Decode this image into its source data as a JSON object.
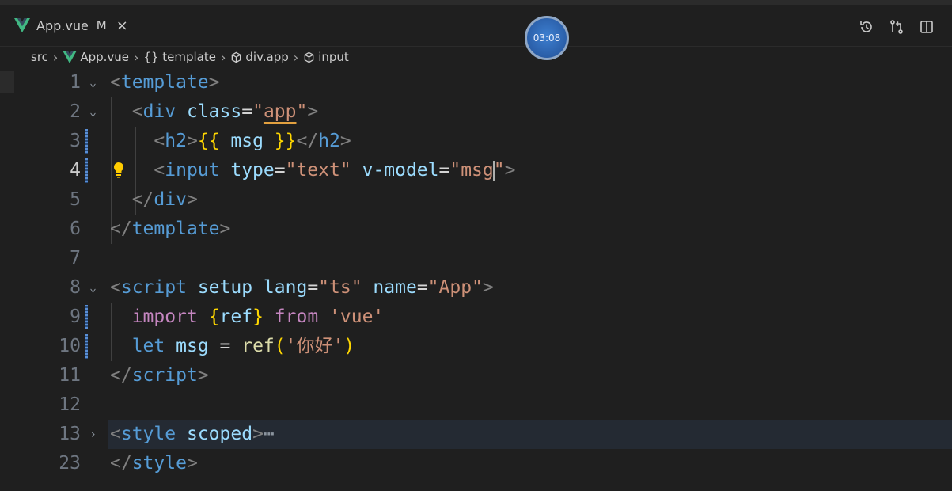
{
  "tab": {
    "filename": "App.vue",
    "modified": "M",
    "close": "×"
  },
  "timer": "03:08",
  "breadcrumb": {
    "src": "src",
    "file": "App.vue",
    "template": "{} template",
    "div": "div.app",
    "input": "input"
  },
  "lines": [
    {
      "n": "1"
    },
    {
      "n": "2"
    },
    {
      "n": "3"
    },
    {
      "n": "4"
    },
    {
      "n": "5"
    },
    {
      "n": "6"
    },
    {
      "n": "7"
    },
    {
      "n": "8"
    },
    {
      "n": "9"
    },
    {
      "n": "10"
    },
    {
      "n": "11"
    },
    {
      "n": "12"
    },
    {
      "n": "13"
    },
    {
      "n": "23"
    }
  ],
  "code": {
    "l1": {
      "tag": "template"
    },
    "l2": {
      "tag": "div",
      "attr": "class",
      "val": "app"
    },
    "l3": {
      "tag": "h2",
      "open": "{{",
      "expr": "msg",
      "close": "}}"
    },
    "l4": {
      "tag": "input",
      "attr1": "type",
      "val1": "\"text\"",
      "attr2": "v-model",
      "val2a": "\"msg",
      "val2b": "\""
    },
    "l5": {
      "tag": "div"
    },
    "l6": {
      "tag": "template"
    },
    "l8": {
      "tag": "script",
      "attr1": "setup",
      "attr2": "lang",
      "val2": "\"ts\"",
      "attr3": "name",
      "val3": "\"App\""
    },
    "l9": {
      "kw": "import",
      "lb": "{",
      "id": "ref",
      "rb": "}",
      "from": "from",
      "mod": "'vue'"
    },
    "l10": {
      "kw": "let",
      "id": "msg",
      "eq": "=",
      "fn": "ref",
      "lp": "(",
      "str": "'你好'",
      "rp": ")"
    },
    "l11": {
      "tag": "script"
    },
    "l13": {
      "tag": "style",
      "attr": "scoped",
      "ell": "⋯"
    },
    "l23": {
      "tag": "style"
    }
  },
  "colors": {
    "background": "#1f1f1f",
    "tag": "#569cd6",
    "attribute": "#9cdcfe",
    "string": "#ce9178",
    "keyword": "#c586c0",
    "function": "#dcdcaa",
    "bracket": "#ffd700"
  }
}
